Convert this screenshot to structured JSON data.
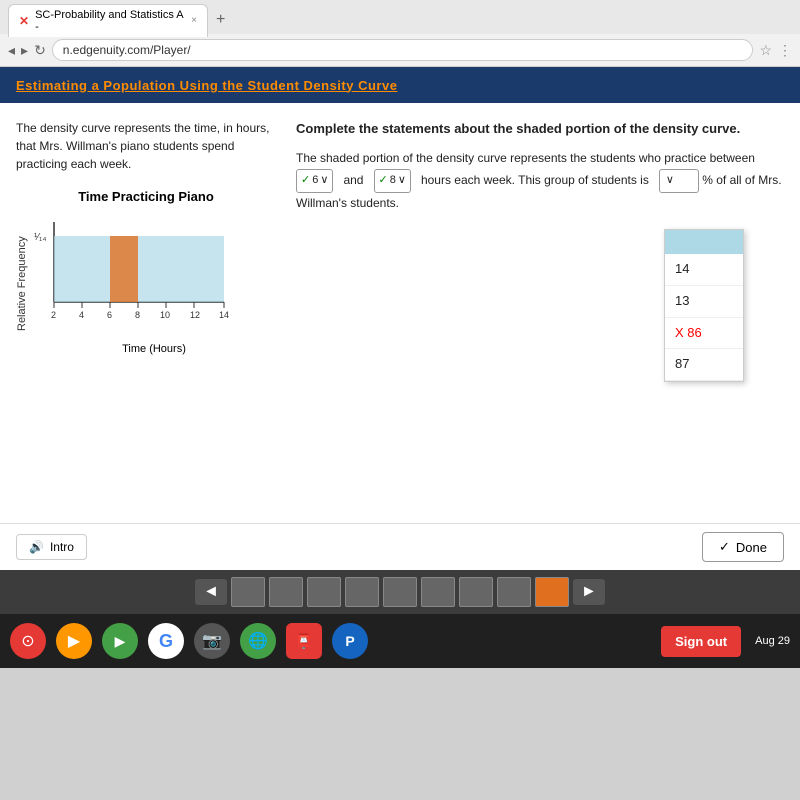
{
  "browser": {
    "tab_title": "SC-Probability and Statistics A -",
    "tab_close": "×",
    "new_tab": "+",
    "address": "n.edgenuity.com/Player/"
  },
  "header": {
    "title": "Estimating a Population Using the Student Density Curve"
  },
  "left_panel": {
    "description": "The density curve represents the time, in hours, that Mrs. Willman's piano students spend practicing each week.",
    "chart_title": "Time Practicing Piano",
    "y_axis_label": "Relative\nFrequency",
    "y_axis_value": "¹⁄₁₄",
    "x_axis_labels": [
      "2",
      "4",
      "6",
      "8",
      "10",
      "12",
      "14"
    ],
    "x_axis_title": "Time (Hours)"
  },
  "right_panel": {
    "complete_title": "Complete the statements about the shaded portion of the density curve.",
    "statement_part1": "The shaded portion of the density curve represents the students who practice between",
    "select1_check": "✓",
    "select1_value": "6",
    "select1_arrow": "∨",
    "statement_part2": "and",
    "select2_check": "✓",
    "select2_value": "8",
    "select2_arrow": "∨",
    "statement_part3": "hours each week. This group of students is",
    "dropdown_arrow": "∨",
    "statement_part4": "% of all of Mrs. Willman's students."
  },
  "dropdown": {
    "options": [
      "14",
      "13",
      "X 86",
      "87"
    ],
    "incorrect_index": 2
  },
  "buttons": {
    "intro": "Intro",
    "done": "Done",
    "done_check": "✓"
  },
  "taskbar": {
    "prev_arrow": "◄",
    "next_arrow": "►",
    "slots": 9
  },
  "system_tray": {
    "sign_out": "Sign out",
    "date": "Aug 29"
  }
}
